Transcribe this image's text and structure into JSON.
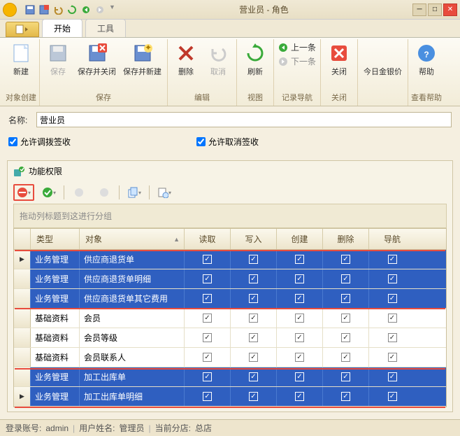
{
  "window": {
    "title": "营业员 - 角色"
  },
  "tabs": {
    "start": "开始",
    "tools": "工具"
  },
  "ribbon": {
    "new": "新建",
    "save": "保存",
    "saveclose": "保存并关闭",
    "savenew": "保存并新建",
    "delete": "删除",
    "cancel": "取消",
    "refresh": "刷新",
    "prev": "上一条",
    "next": "下一条",
    "close": "关闭",
    "gold": "今日金银价",
    "help": "帮助",
    "g_obj": "对象创建",
    "g_save": "保存",
    "g_edit": "编辑",
    "g_view": "视图",
    "g_nav": "记录导航",
    "g_close": "关闭",
    "g_help": "查看帮助"
  },
  "form": {
    "name_label": "名称:",
    "name_value": "营业员",
    "allow_transfer": "允许调拨签收",
    "allow_cancel": "允许取消签收"
  },
  "perm": {
    "title": "功能权限",
    "group_hint": "拖动列标题到这进行分组"
  },
  "grid": {
    "cols": {
      "type": "类型",
      "object": "对象",
      "read": "读取",
      "write": "写入",
      "create": "创建",
      "delete": "删除",
      "nav": "导航"
    },
    "rows": [
      {
        "sel": true,
        "type": "业务管理",
        "object": "供应商退货单",
        "r": true,
        "w": true,
        "c": true,
        "d": true,
        "n": true,
        "ind": true
      },
      {
        "sel": true,
        "type": "业务管理",
        "object": "供应商退货单明细",
        "r": true,
        "w": true,
        "c": true,
        "d": true,
        "n": true
      },
      {
        "sel": true,
        "type": "业务管理",
        "object": "供应商退货单其它费用",
        "r": true,
        "w": true,
        "c": true,
        "d": true,
        "n": true
      },
      {
        "sel": false,
        "type": "基础资料",
        "object": "会员",
        "r": true,
        "w": true,
        "c": true,
        "d": true,
        "n": true
      },
      {
        "sel": false,
        "type": "基础资料",
        "object": "会员等级",
        "r": true,
        "w": true,
        "c": true,
        "d": true,
        "n": true
      },
      {
        "sel": false,
        "type": "基础资料",
        "object": "会员联系人",
        "r": true,
        "w": true,
        "c": true,
        "d": true,
        "n": true
      },
      {
        "sel": true,
        "type": "业务管理",
        "object": "加工出库单",
        "r": true,
        "w": true,
        "c": true,
        "d": true,
        "n": true
      },
      {
        "sel": true,
        "type": "业务管理",
        "object": "加工出库单明细",
        "r": true,
        "w": true,
        "c": true,
        "d": true,
        "n": true,
        "ind": true
      }
    ]
  },
  "status": {
    "account_l": "登录账号:",
    "account_v": "admin",
    "user_l": "用户姓名:",
    "user_v": "管理员",
    "store_l": "当前分店:",
    "store_v": "总店"
  }
}
